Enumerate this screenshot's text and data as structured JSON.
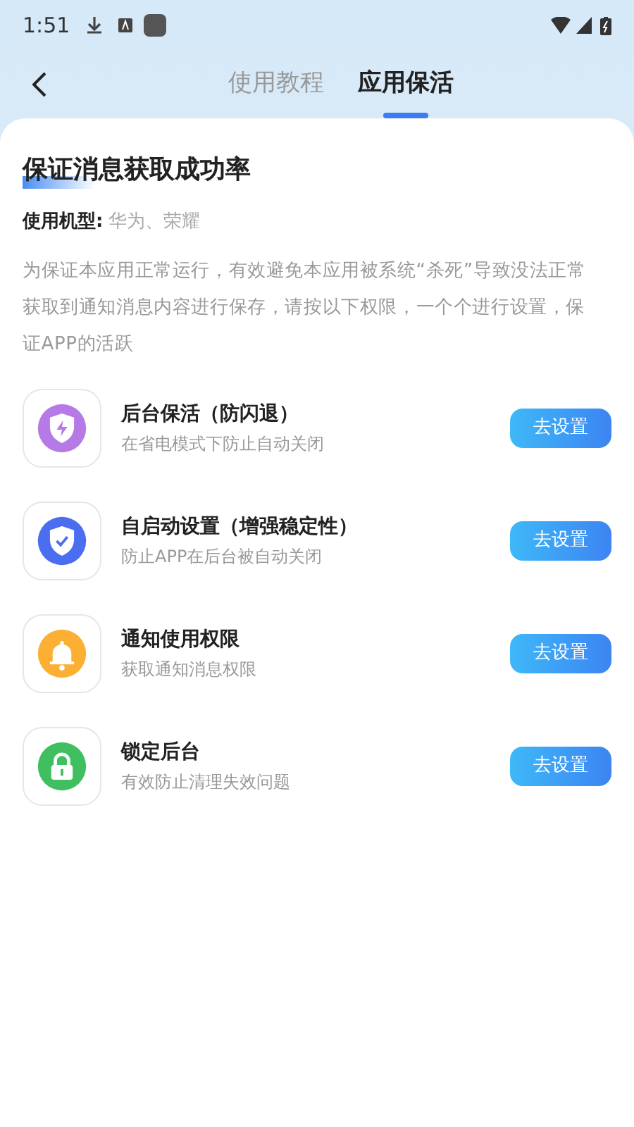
{
  "status_bar": {
    "time": "1:51"
  },
  "tabs": [
    {
      "label": "使用教程",
      "selected": false
    },
    {
      "label": "应用保活",
      "selected": true
    }
  ],
  "title": "保证消息获取成功率",
  "models": {
    "label": "使用机型:",
    "value": "华为、荣耀"
  },
  "description": "为保证本应用正常运行，有效避免本应用被系统“杀死”导致没法正常获取到通知消息内容进行保存，请按以下权限，一个个进行设置，保证APP的活跃",
  "items": [
    {
      "kind": "shield-bolt",
      "color": "#b57ae6",
      "title": "后台保活（防闪退）",
      "subtitle": "在省电模式下防止自动关闭",
      "button": "去设置"
    },
    {
      "kind": "shield-check",
      "color": "#4b6ef0",
      "title": "自启动设置（增强稳定性）",
      "subtitle": "防止APP在后台被自动关闭",
      "button": "去设置"
    },
    {
      "kind": "bell",
      "color": "#fbb034",
      "title": "通知使用权限",
      "subtitle": "获取通知消息权限",
      "button": "去设置"
    },
    {
      "kind": "lock",
      "color": "#3fbf5f",
      "title": "锁定后台",
      "subtitle": "有效防止清理失效问题",
      "button": "去设置"
    }
  ]
}
